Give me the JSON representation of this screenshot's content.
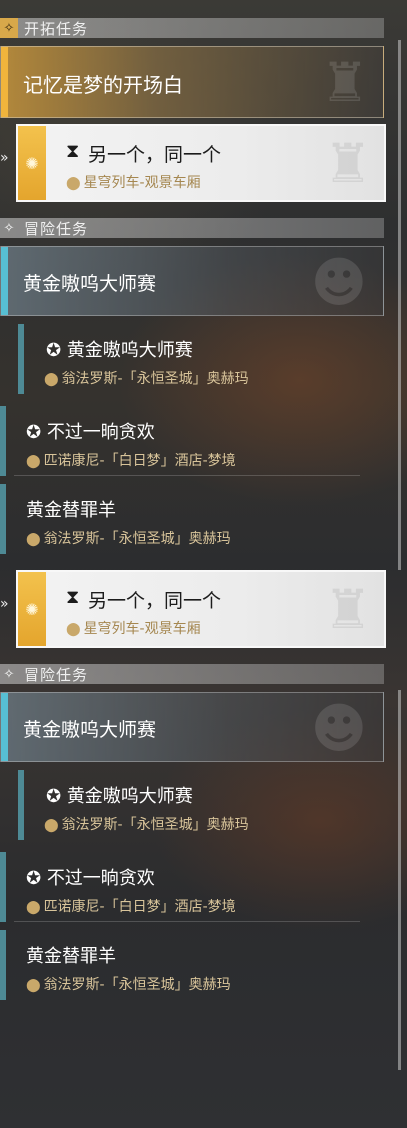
{
  "trailblaze": {
    "header": "开拓任务",
    "main_title": "记忆是梦的开场白",
    "selected_quest": {
      "title": "另一个，同一个",
      "location": "星穹列车-观景车厢"
    }
  },
  "adventure": {
    "header": "冒险任务",
    "group_title": "黄金嗷呜大师赛",
    "items": [
      {
        "title": "黄金嗷呜大师赛",
        "location": "翁法罗斯-「永恒圣城」奥赫玛"
      },
      {
        "title": "不过一晌贪欢",
        "location": "匹诺康尼-「白日梦」酒店-梦境"
      },
      {
        "title": "黄金替罪羊",
        "location": "翁法罗斯-「永恒圣城」奥赫玛"
      }
    ]
  },
  "icons": {
    "trailblaze": "diamond-star-icon",
    "adventure": "diamond-star-icon",
    "hourglass": "hourglass-icon",
    "paw": "paw-icon",
    "location": "location-pin-icon"
  },
  "colors": {
    "gold_accent": "#f0b43c",
    "cyan_accent": "#57bfd3",
    "teal_bar": "#4e8a95",
    "location_text": "#d8c49a"
  }
}
